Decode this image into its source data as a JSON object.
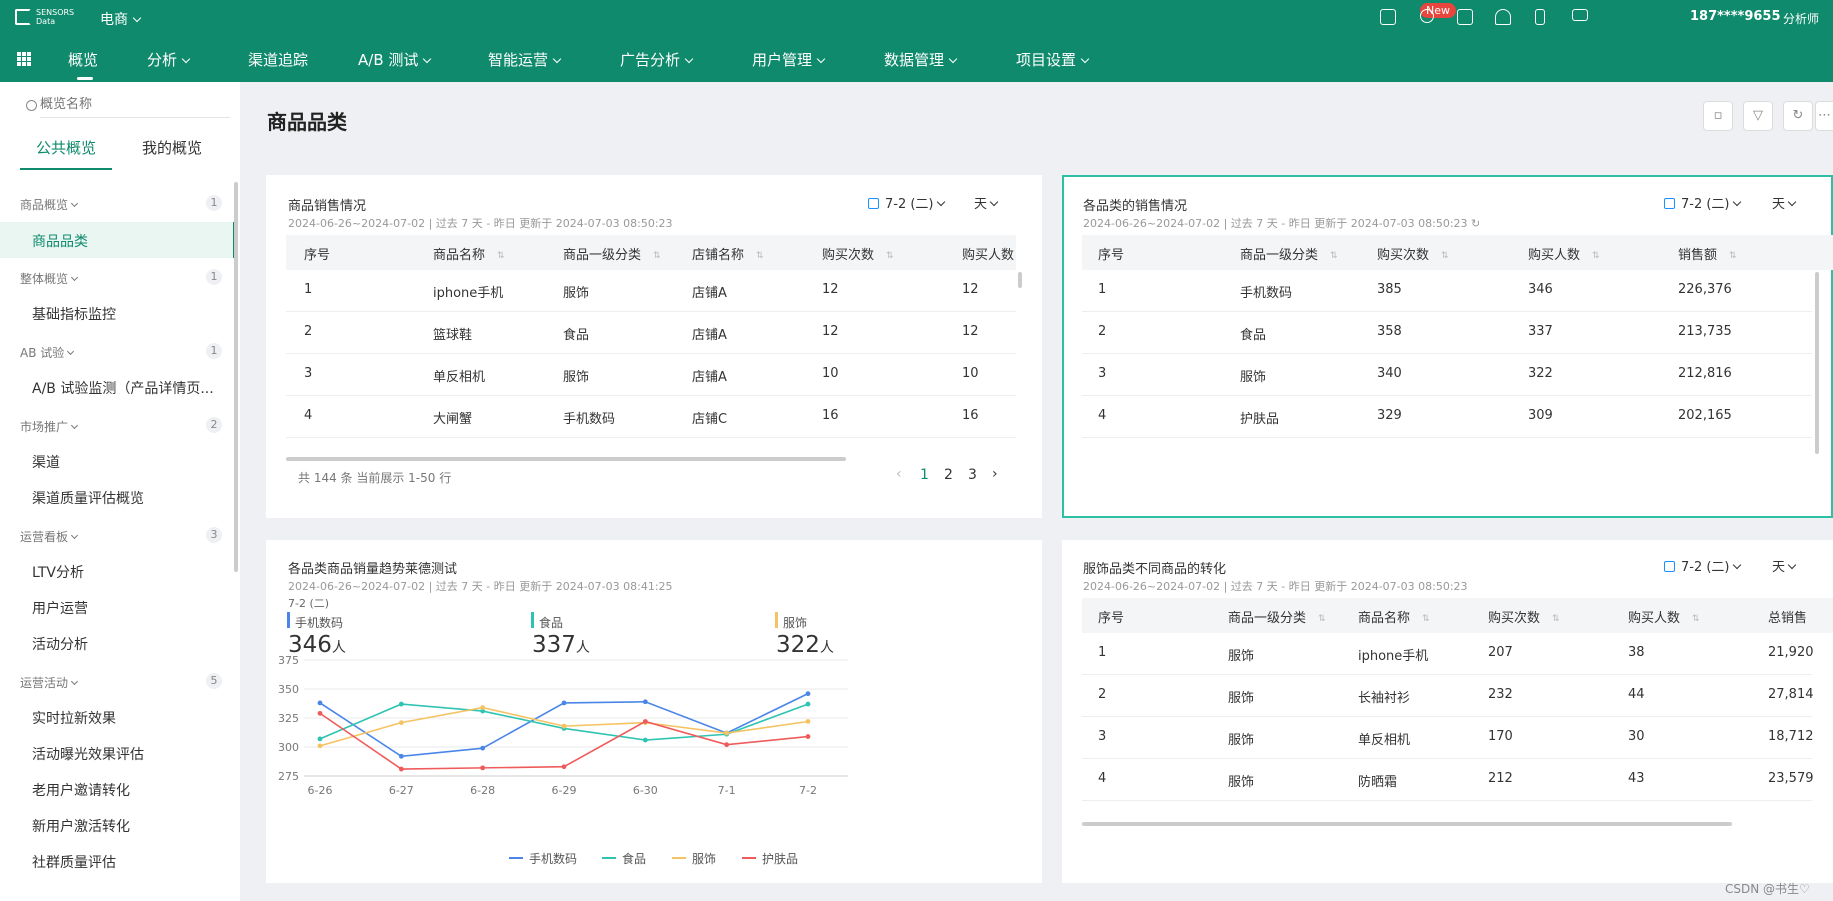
{
  "topbar": {
    "logo_line1": "SENSORS",
    "logo_line2": "Data",
    "project": "电商",
    "new_badge": "New",
    "user": "187****9655",
    "role": "分析师"
  },
  "nav": {
    "items": [
      "概览",
      "分析",
      "渠道追踪",
      "A/B 测试",
      "智能运营",
      "广告分析",
      "用户管理",
      "数据管理",
      "项目设置"
    ],
    "has_dropdown": [
      false,
      true,
      false,
      true,
      true,
      true,
      true,
      true,
      true
    ]
  },
  "sidebar": {
    "search_placeholder": "概览名称",
    "tabs": [
      "公共概览",
      "我的概览"
    ],
    "groups": [
      {
        "label": "商品概览",
        "count": "1",
        "items": [
          "商品品类"
        ]
      },
      {
        "label": "整体概览",
        "count": "1",
        "items": [
          "基础指标监控"
        ]
      },
      {
        "label": "AB 试验",
        "count": "1",
        "items": [
          "A/B 试验监测（产品详情页..."
        ]
      },
      {
        "label": "市场推广",
        "count": "2",
        "items": [
          "渠道",
          "渠道质量评估概览"
        ]
      },
      {
        "label": "运营看板",
        "count": "3",
        "items": [
          "LTV分析",
          "用户运营",
          "活动分析"
        ]
      },
      {
        "label": "运营活动",
        "count": "5",
        "items": [
          "实时拉新效果",
          "活动曝光效果评估",
          "老用户邀请转化",
          "新用户激活转化",
          "社群质量评估"
        ]
      }
    ]
  },
  "page": {
    "title": "商品品类"
  },
  "cards": {
    "sales": {
      "title": "商品销售情况",
      "subtitle": "2024-06-26~2024-07-02 | 过去 7 天 - 昨日 更新于 2024-07-03 08:50:23",
      "date_range": "7-2 (二)",
      "granularity": "天",
      "columns": [
        "序号",
        "商品名称",
        "商品一级分类",
        "店铺名称",
        "购买次数",
        "购买人数"
      ],
      "rows": [
        [
          "1",
          "iphone手机",
          "服饰",
          "店铺A",
          "12",
          "12"
        ],
        [
          "2",
          "篮球鞋",
          "食品",
          "店铺A",
          "12",
          "12"
        ],
        [
          "3",
          "单反相机",
          "服饰",
          "店铺A",
          "10",
          "10"
        ],
        [
          "4",
          "大闸蟹",
          "手机数码",
          "店铺C",
          "16",
          "16"
        ]
      ],
      "summary": "共 144 条 当前展示 1-50 行",
      "pages": [
        "1",
        "2",
        "3"
      ]
    },
    "category": {
      "title": "各品类的销售情况",
      "subtitle": "2024-06-26~2024-07-02 | 过去 7 天 - 昨日 更新于 2024-07-03 08:50:23",
      "date_range": "7-2 (二)",
      "granularity": "天",
      "columns": [
        "序号",
        "商品一级分类",
        "购买次数",
        "购买人数",
        "销售额"
      ],
      "rows": [
        [
          "1",
          "手机数码",
          "385",
          "346",
          "226,376"
        ],
        [
          "2",
          "食品",
          "358",
          "337",
          "213,735"
        ],
        [
          "3",
          "服饰",
          "340",
          "322",
          "212,816"
        ],
        [
          "4",
          "护肤品",
          "329",
          "309",
          "202,165"
        ]
      ]
    },
    "trend": {
      "title": "各品类商品销量趋势莱德测试",
      "subtitle": "2024-06-26~2024-07-02 | 过去 7 天 - 昨日 更新于 2024-07-03 08:41:25",
      "date_label": "7-2 (二)",
      "metrics": [
        {
          "label": "手机数码",
          "value": "346",
          "unit": "人",
          "color": "#4a86e8"
        },
        {
          "label": "食品",
          "value": "337",
          "unit": "人",
          "color": "#2fc4b2"
        },
        {
          "label": "服饰",
          "value": "322",
          "unit": "人",
          "color": "#f5c363"
        }
      ]
    },
    "apparel": {
      "title": "服饰品类不同商品的转化",
      "subtitle": "2024-06-26~2024-07-02 | 过去 7 天 - 昨日 更新于 2024-07-03 08:50:23",
      "date_range": "7-2 (二)",
      "granularity": "天",
      "columns": [
        "序号",
        "商品一级分类",
        "商品名称",
        "购买次数",
        "购买人数",
        "总销售"
      ],
      "rows": [
        [
          "1",
          "服饰",
          "iphone手机",
          "207",
          "38",
          "21,920"
        ],
        [
          "2",
          "服饰",
          "长袖衬衫",
          "232",
          "44",
          "27,814"
        ],
        [
          "3",
          "服饰",
          "单反相机",
          "170",
          "30",
          "18,712"
        ],
        [
          "4",
          "服饰",
          "防晒霜",
          "212",
          "43",
          "23,579"
        ]
      ]
    }
  },
  "chart_data": {
    "type": "line",
    "categories": [
      "6-26",
      "6-27",
      "6-28",
      "6-29",
      "6-30",
      "7-1",
      "7-2"
    ],
    "ylim": [
      275,
      375
    ],
    "yticks": [
      275,
      300,
      325,
      350,
      375
    ],
    "grid": true,
    "legend": "bottom",
    "series": [
      {
        "name": "手机数码",
        "color": "#4a86e8",
        "values": [
          338,
          292,
          299,
          338,
          339,
          312,
          346
        ]
      },
      {
        "name": "食品",
        "color": "#2fc4b2",
        "values": [
          307,
          337,
          331,
          316,
          306,
          311,
          337
        ]
      },
      {
        "name": "服饰",
        "color": "#f5c363",
        "values": [
          301,
          321,
          334,
          318,
          321,
          312,
          322
        ]
      },
      {
        "name": "护肤品",
        "color": "#ef5b5b",
        "values": [
          329,
          281,
          282,
          283,
          322,
          302,
          309
        ]
      }
    ]
  },
  "footer": {
    "watermark": "CSDN @书生♡"
  }
}
